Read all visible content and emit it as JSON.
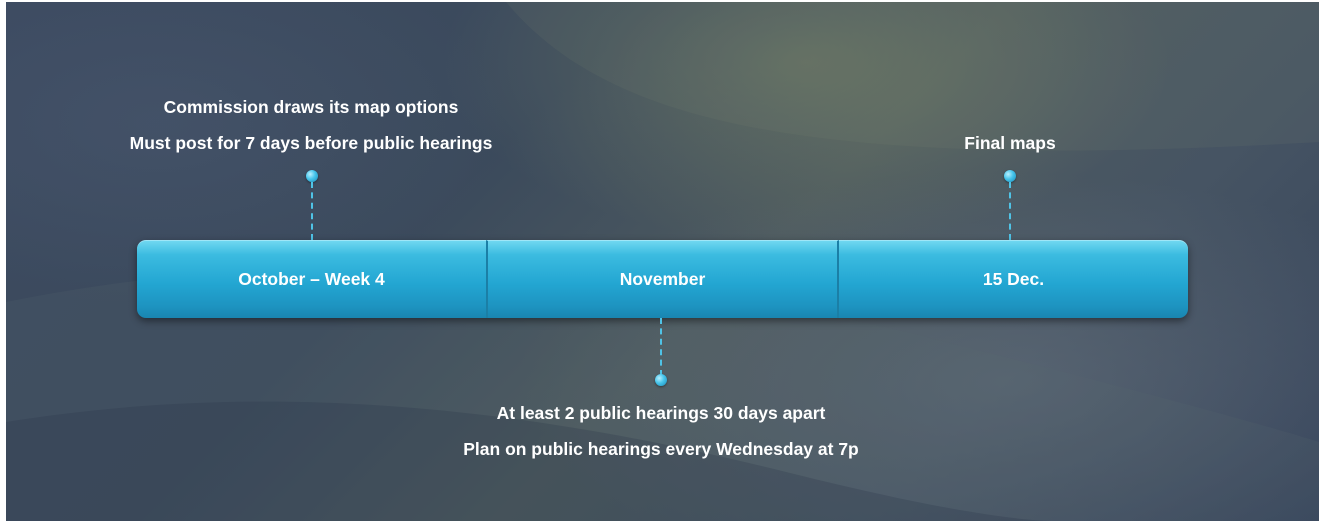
{
  "timeline": {
    "segments": [
      {
        "label": "October – Week 4"
      },
      {
        "label": "November"
      },
      {
        "label": "15 Dec."
      }
    ],
    "callouts": {
      "commission": {
        "line1": "Commission draws its map options",
        "line2": "Must post for 7 days before public hearings"
      },
      "final": {
        "line1": "Final maps"
      },
      "hearings": {
        "line1": "At least 2 public hearings 30 days apart",
        "line2": "Plan on public hearings every Wednesday at 7p"
      }
    }
  },
  "colors": {
    "bar": "#23a6d2",
    "accent": "#4fc3e6",
    "background": "#3b4a5c",
    "text": "#ffffff"
  }
}
